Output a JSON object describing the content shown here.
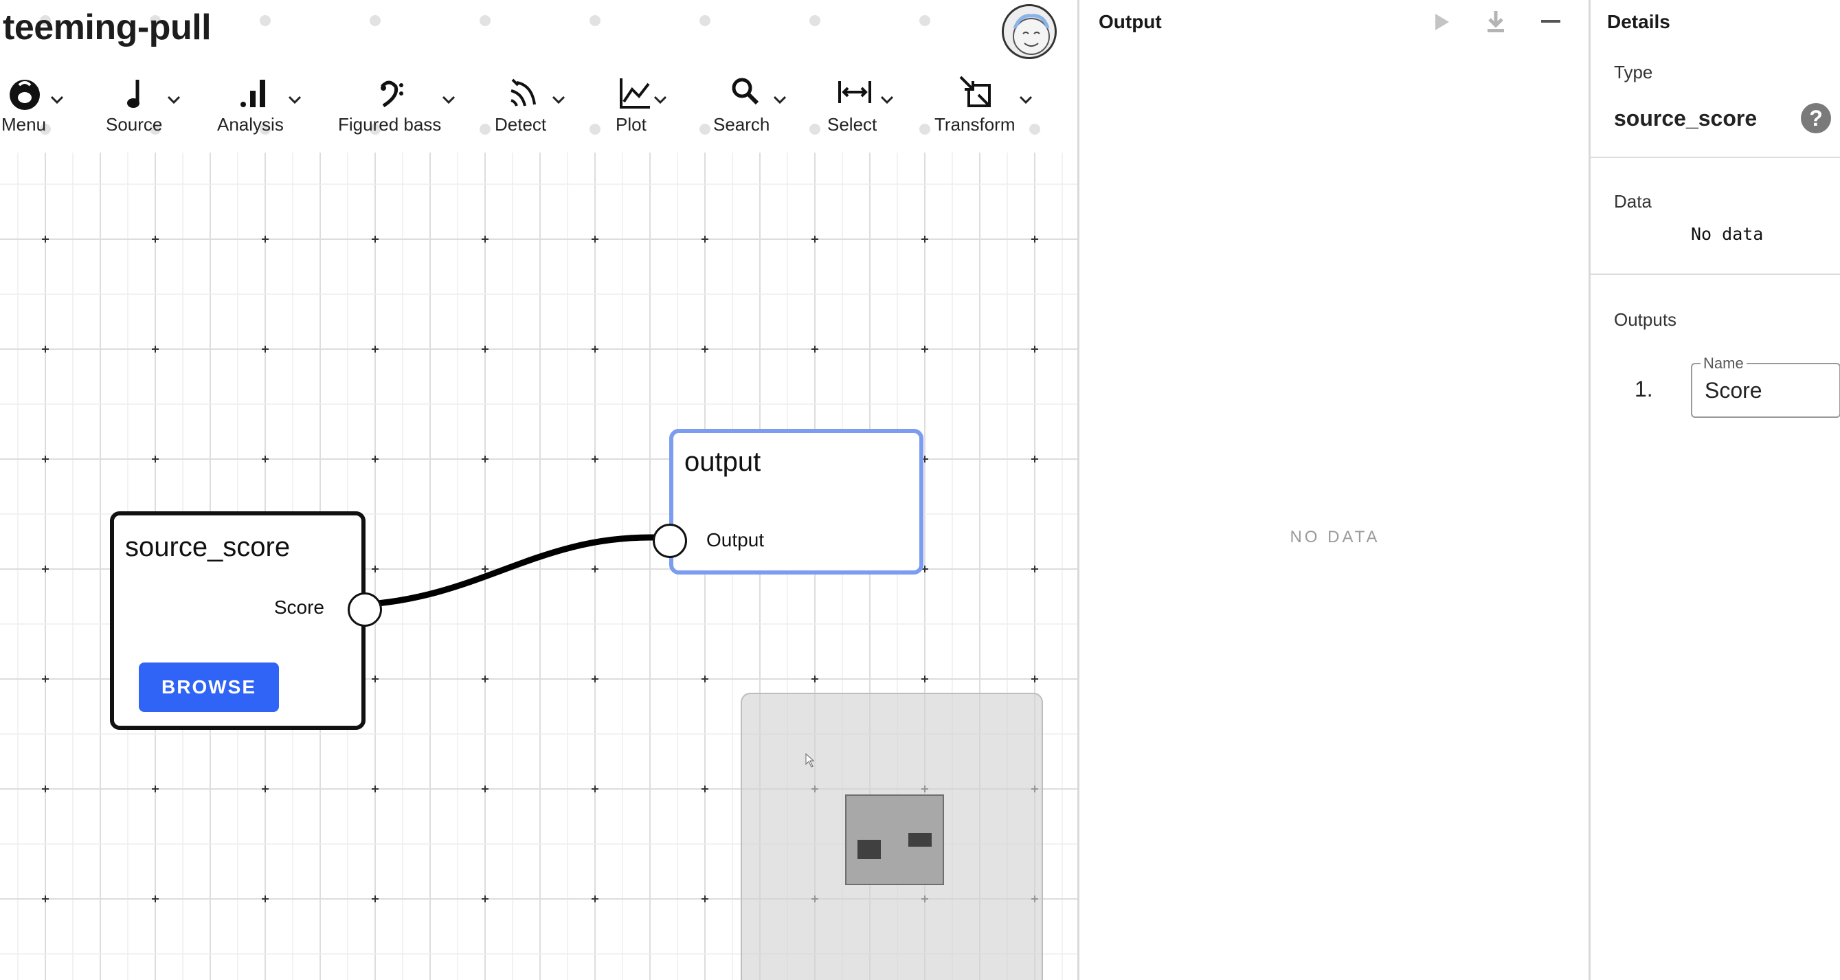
{
  "app": {
    "title": "teeming-pull",
    "avatar_icon": "user-avatar-cartoon"
  },
  "toolbar": {
    "items": [
      {
        "label": "Menu",
        "icon": "menu-logo-icon"
      },
      {
        "label": "Source",
        "icon": "music-note-icon"
      },
      {
        "label": "Analysis",
        "icon": "bar-chart-icon"
      },
      {
        "label": "Figured bass",
        "icon": "bass-clef-icon"
      },
      {
        "label": "Detect",
        "icon": "signal-waves-icon"
      },
      {
        "label": "Plot",
        "icon": "line-chart-icon"
      },
      {
        "label": "Search",
        "icon": "magnifier-icon"
      },
      {
        "label": "Select",
        "icon": "range-select-icon"
      },
      {
        "label": "Transform",
        "icon": "transform-arrows-icon"
      }
    ]
  },
  "graph": {
    "nodes": {
      "source": {
        "title": "source_score",
        "output_port": "Score",
        "button": "BROWSE"
      },
      "output": {
        "title": "output",
        "input_port": "Output"
      }
    },
    "edge_color": "#000000",
    "selected_node_color": "#7b9cf0",
    "button_color": "#2f64f6"
  },
  "output_panel": {
    "title": "Output",
    "empty_text": "NO DATA",
    "icons": [
      "play-icon",
      "download-icon",
      "minimize-icon"
    ]
  },
  "details": {
    "title": "Details",
    "type_label": "Type",
    "type_value": "source_score",
    "data_label": "Data",
    "data_value": "No data",
    "outputs_label": "Outputs",
    "outputs": [
      {
        "index": "1.",
        "field_label": "Name",
        "value": "Score"
      }
    ]
  }
}
